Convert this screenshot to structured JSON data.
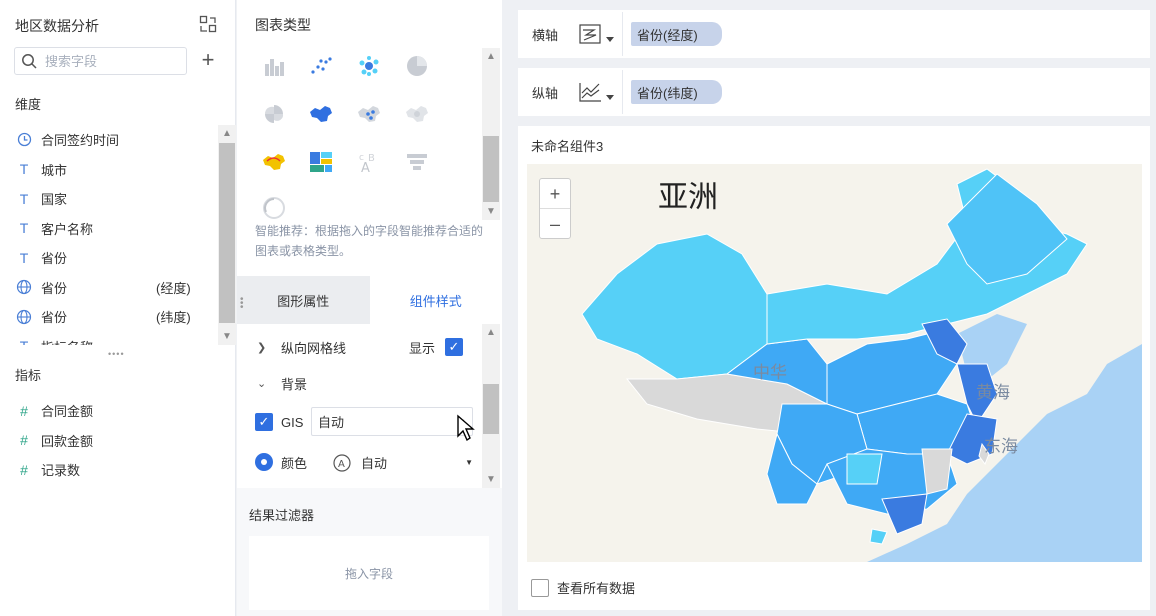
{
  "left_panel": {
    "title": "地区数据分析",
    "search_placeholder": "搜索字段",
    "dimensions_label": "维度",
    "dimensions": [
      {
        "icon": "clock-icon",
        "label": "合同签约时间",
        "suffix": ""
      },
      {
        "icon": "text-type-icon",
        "label": "城市",
        "suffix": ""
      },
      {
        "icon": "text-type-icon",
        "label": "国家",
        "suffix": ""
      },
      {
        "icon": "text-type-icon",
        "label": "客户名称",
        "suffix": ""
      },
      {
        "icon": "text-type-icon",
        "label": "省份",
        "suffix": ""
      },
      {
        "icon": "globe-icon",
        "label": "省份",
        "suffix": "(经度)"
      },
      {
        "icon": "globe-icon",
        "label": "省份",
        "suffix": "(纬度)"
      },
      {
        "icon": "text-type-icon",
        "label": "指标名称",
        "suffix": ""
      }
    ],
    "measures_label": "指标",
    "measures": [
      {
        "icon": "number-icon",
        "label": "合同金额"
      },
      {
        "icon": "number-icon",
        "label": "回款金额"
      },
      {
        "icon": "number-icon",
        "label": "记录数"
      }
    ]
  },
  "middle_panel": {
    "chart_type_title": "图表类型",
    "chart_types": [
      "grouped-bar-chart-icon",
      "scatter-chart-icon",
      "bubble-chart-icon",
      "pie-chart-icon",
      "rose-chart-icon",
      "region-map-icon",
      "point-map-icon",
      "heat-map-icon",
      "flow-map-icon",
      "treemap-icon",
      "word-cloud-icon",
      "funnel-icon",
      "gauge-icon"
    ],
    "smart_tip": "智能推荐：根据拖入的字段智能推荐合适的图表或表格类型。",
    "tabs": {
      "shape_props": "图形属性",
      "component_style": "组件样式"
    },
    "props": {
      "vertical_grid_label": "纵向网格线",
      "show_label": "显示",
      "background_label": "背景",
      "gis_label": "GIS",
      "gis_value": "自动",
      "color_label": "颜色",
      "color_value": "自动"
    },
    "filter_title": "结果过滤器",
    "filter_drop": "拖入字段"
  },
  "right_panel": {
    "x_axis_label": "横轴",
    "x_axis_field": "省份(经度)",
    "y_axis_label": "纵轴",
    "y_axis_field": "省份(纬度)",
    "widget_title": "未命名组件3",
    "map_labels": {
      "asia": "亚洲",
      "china": "中华",
      "yellow_sea": "黄海",
      "east_sea": "东海"
    },
    "zoom_in": "+",
    "zoom_out": "–",
    "show_all_label": "查看所有数据"
  },
  "colors": {
    "accent": "#2f6fe0",
    "chip": "#c7d3ea",
    "map_water": "#a9d2f5",
    "region_light": "#56d0f7",
    "region_mid": "#3fa9f5",
    "region_dark": "#3a7be0"
  }
}
